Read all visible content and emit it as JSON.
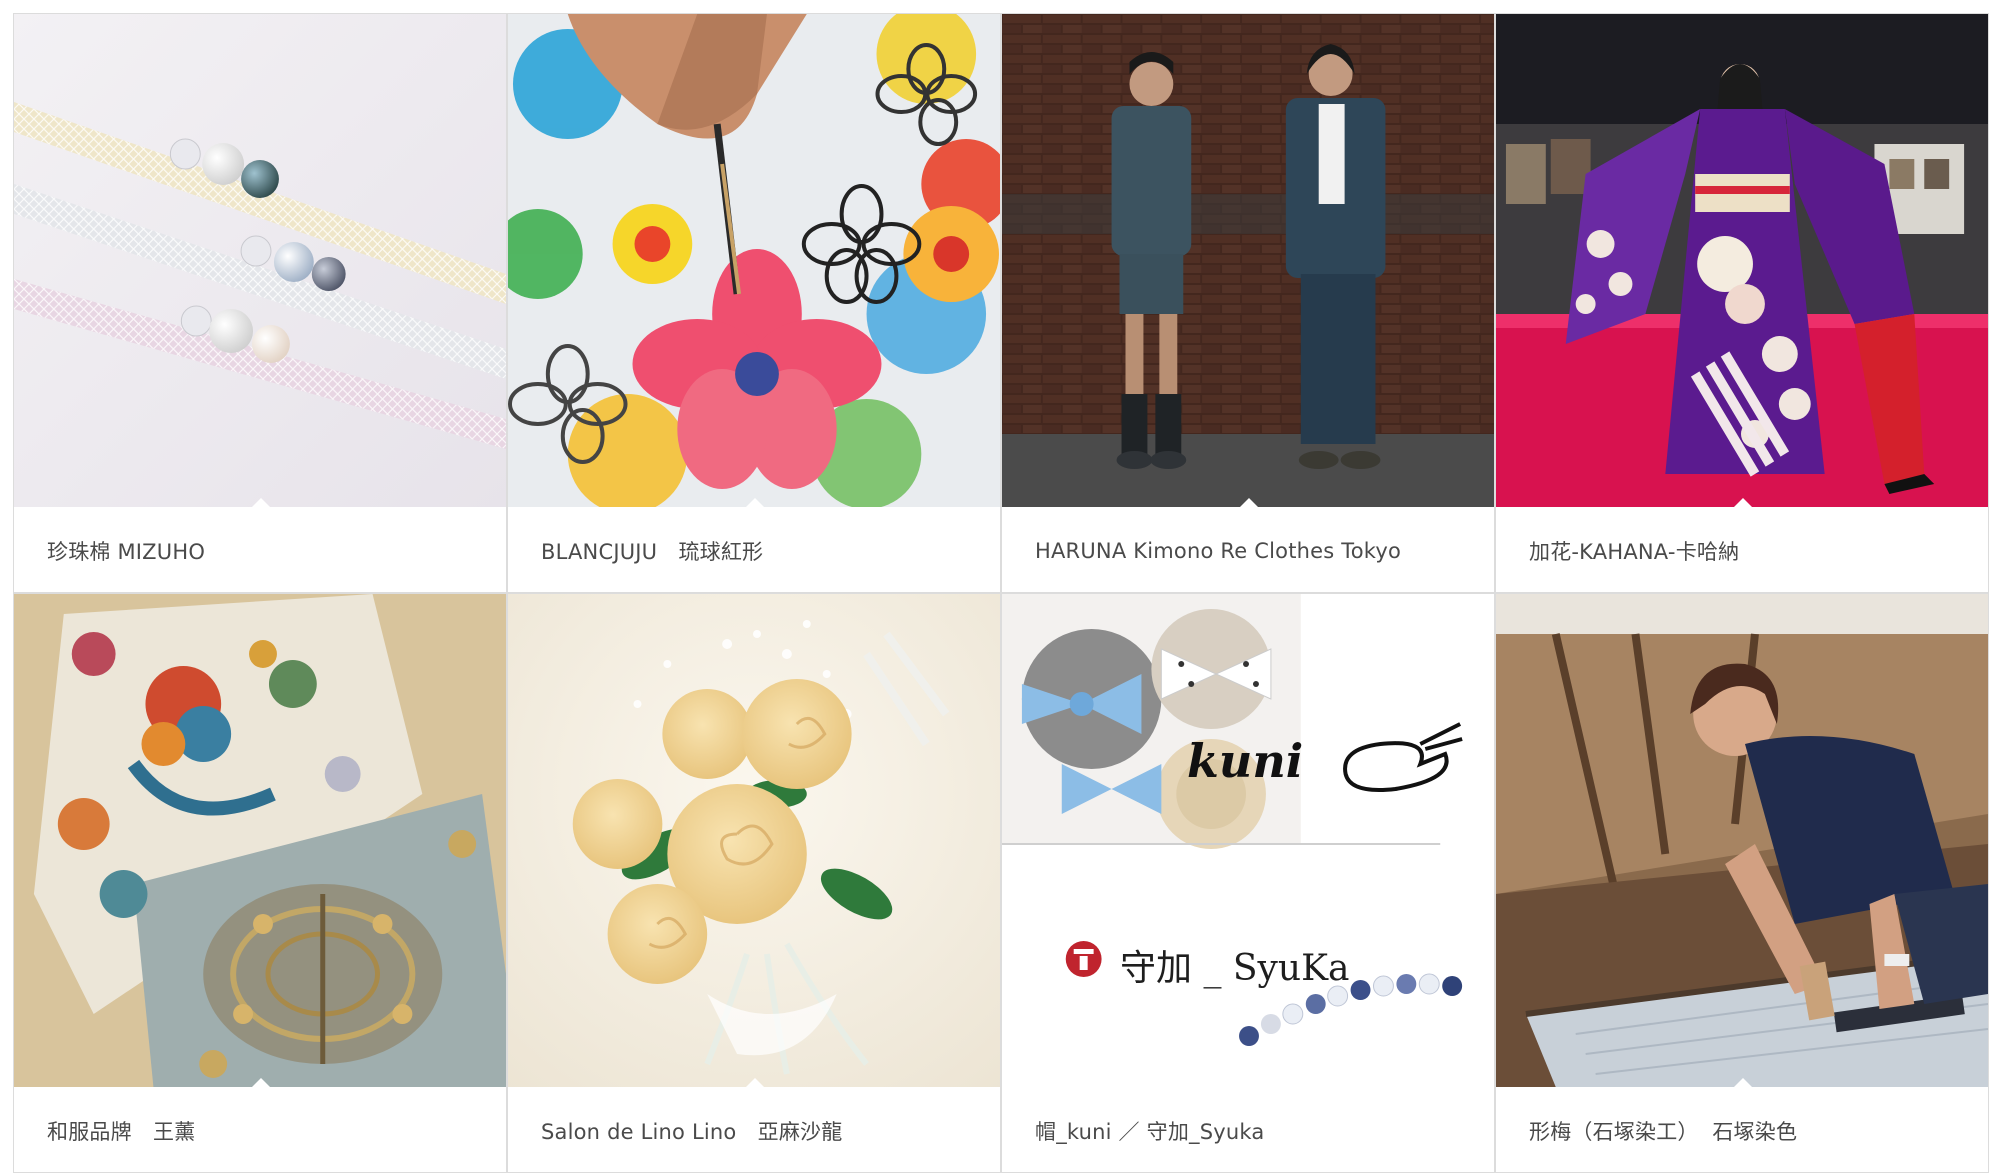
{
  "cards": [
    {
      "caption": "珍珠棉 MIZUHO",
      "image": "pearl obi-jime cords"
    },
    {
      "caption": "BLANCJUJU　琉球紅形",
      "image": "hand painting bingata flowers"
    },
    {
      "caption": "HARUNA Kimono Re Clothes Tokyo",
      "image": "two men in front of brick wall"
    },
    {
      "caption": "加花-KAHANA-卡哈納",
      "image": "model in purple kimono on red stage"
    },
    {
      "caption": "和服品牌　王薰",
      "image": "embroidered obi with phoenix"
    },
    {
      "caption": "Salon de Lino Lino　亞麻沙龍",
      "image": "cream linen rose bouquet"
    },
    {
      "caption": "帽_kuni ／ 守加_Syuka",
      "image": "hats and beaded bracelet"
    },
    {
      "caption": "形梅（石塚染工）  石塚染色",
      "image": "artisan dyeing fabric"
    }
  ],
  "kuni_logo": "kuni",
  "syuka_logo": "守加 _ SyuKa",
  "slider_dots": 6,
  "active_dot": 0
}
